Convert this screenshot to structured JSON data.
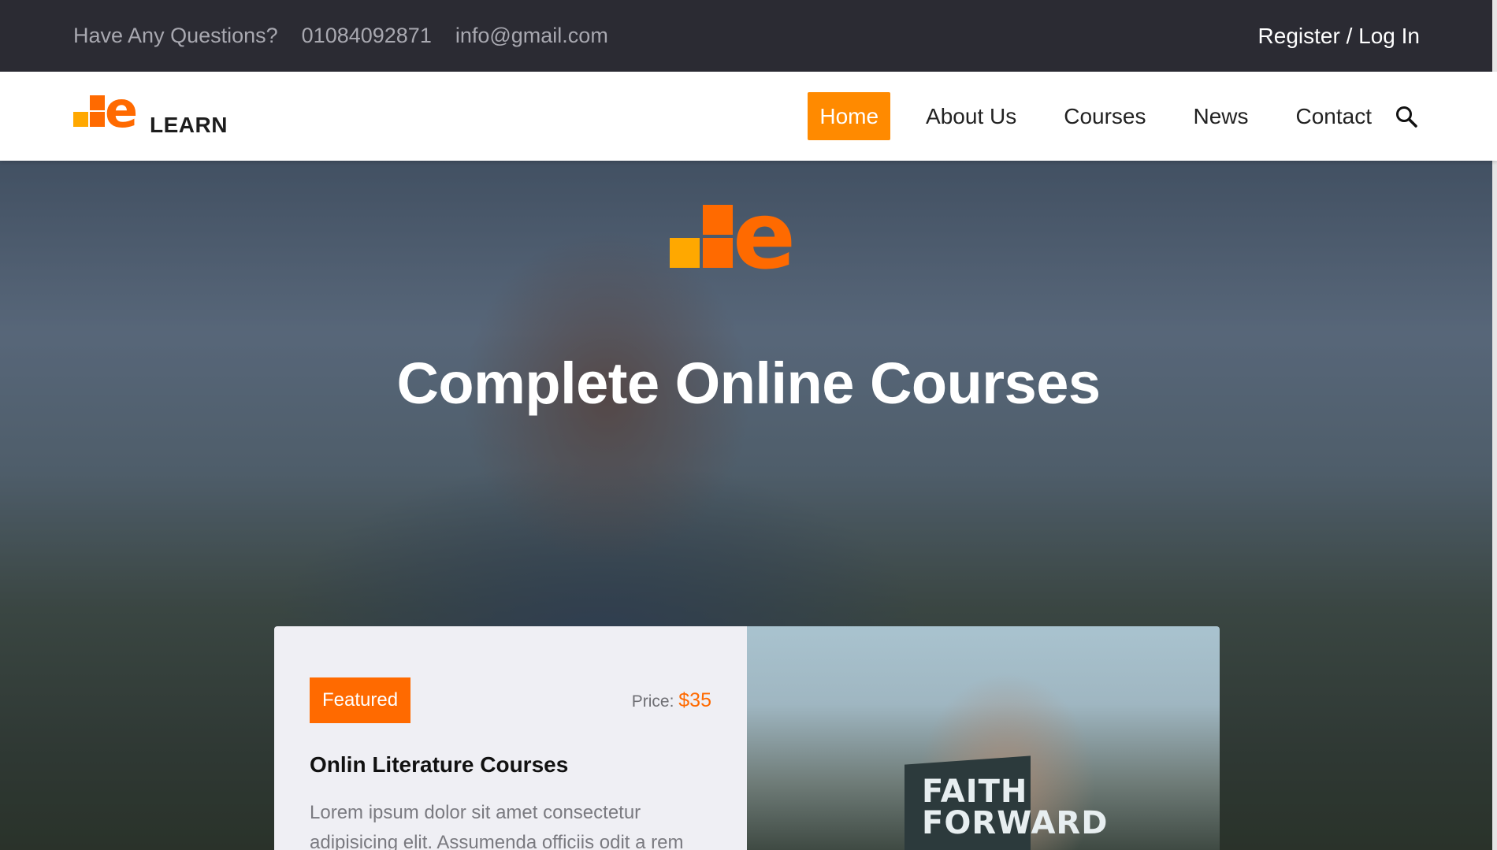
{
  "topbar": {
    "question": "Have Any Questions?",
    "phone": "01084092871",
    "email": "info@gmail.com",
    "login": "Register / Log In"
  },
  "brand": {
    "logo_text": "LEARN",
    "logo_letter": "e",
    "accent_orange": "#ff6a00",
    "accent_yellow": "#ffa800"
  },
  "nav": {
    "items": [
      {
        "label": "Home",
        "active": true
      },
      {
        "label": "About Us"
      },
      {
        "label": "Courses"
      },
      {
        "label": "News"
      },
      {
        "label": "Contact"
      }
    ],
    "search_icon": "search-icon"
  },
  "hero": {
    "title": "Complete Online Courses"
  },
  "course_card": {
    "badge": "Featured",
    "price_label": "Price:",
    "price_value": "$35",
    "title": "Onlin Literature Courses",
    "description": "Lorem ipsum dolor sit amet consectetur adipisicing elit. Assumenda officiis odit a rem",
    "image_book_text": "FAITH FORWARD"
  }
}
